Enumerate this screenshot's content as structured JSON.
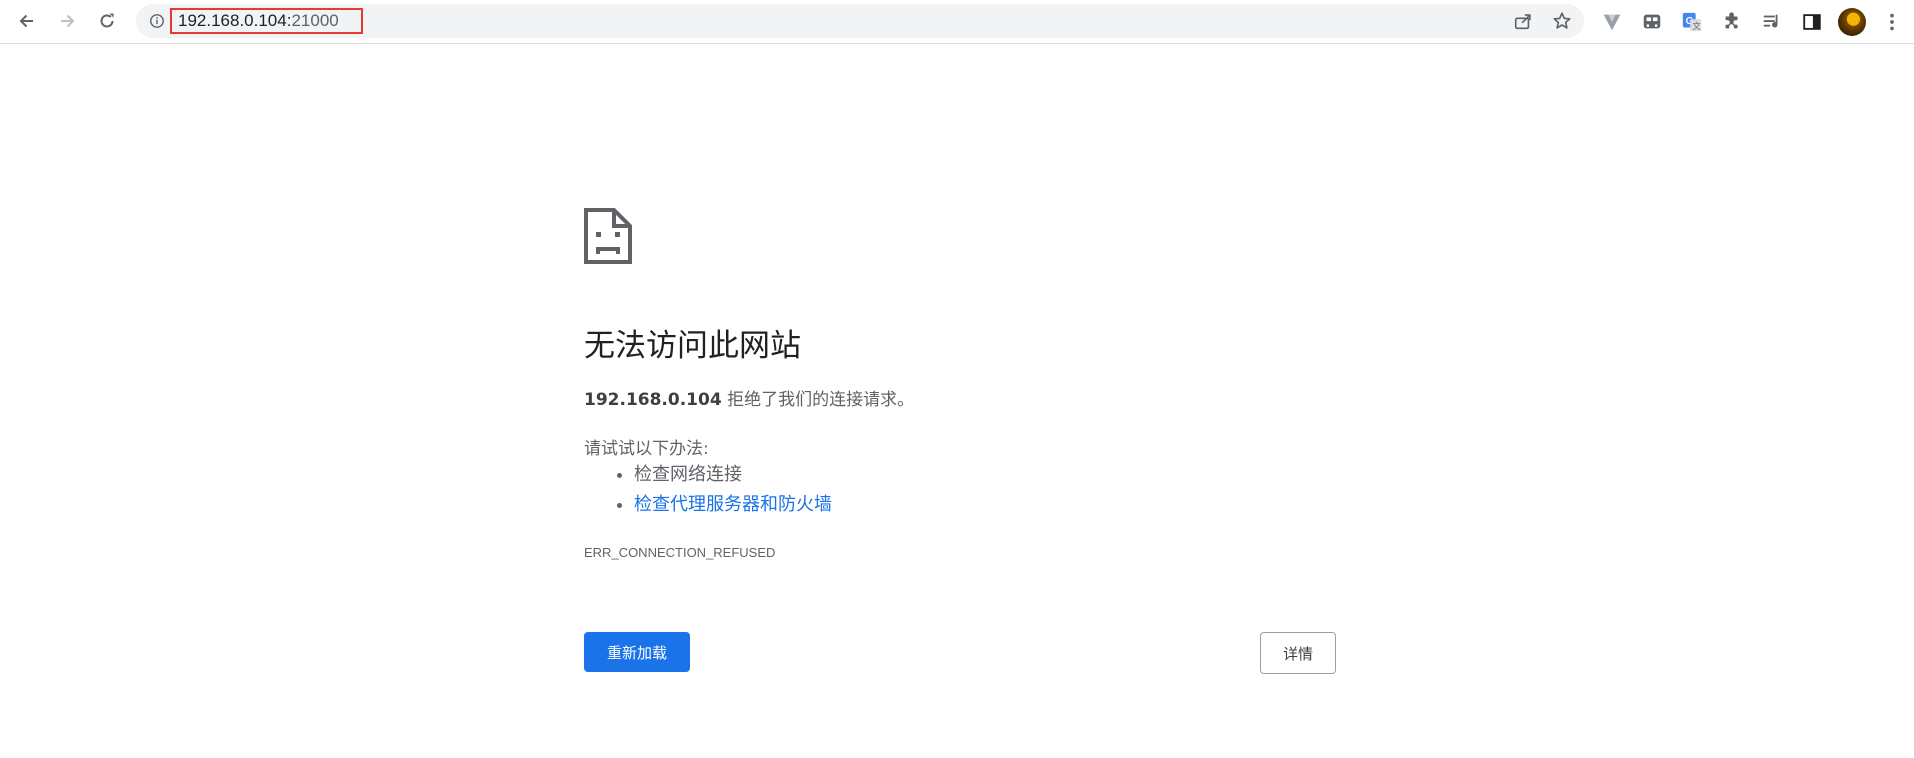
{
  "toolbar": {
    "url_host": "192.168.0.104:",
    "url_port": "21000",
    "icons": {
      "back": "arrow-left",
      "forward": "arrow-right",
      "reload": "reload",
      "site_info": "info-circle",
      "share": "share",
      "bookmark": "star",
      "extensions": [
        "v-logo",
        "bus-toolbar",
        "google-translate",
        "puzzle-piece",
        "reading-list",
        "side-panel"
      ],
      "menu": "three-dots-vertical"
    }
  },
  "error": {
    "icon": "sad-document",
    "title": "无法访问此网站",
    "host": "192.168.0.104",
    "summary_tail": " 拒绝了我们的连接请求。",
    "suggestions_heading": "请试试以下办法:",
    "suggestions": [
      {
        "text": "检查网络连接",
        "link": false
      },
      {
        "text": "检查代理服务器和防火墙",
        "link": true
      }
    ],
    "code": "ERR_CONNECTION_REFUSED",
    "reload_label": "重新加载",
    "details_label": "详情"
  },
  "colors": {
    "accent": "#1a73e8",
    "url_highlight": "#e53935",
    "text_primary": "#202124",
    "text_secondary": "#5f6368"
  }
}
